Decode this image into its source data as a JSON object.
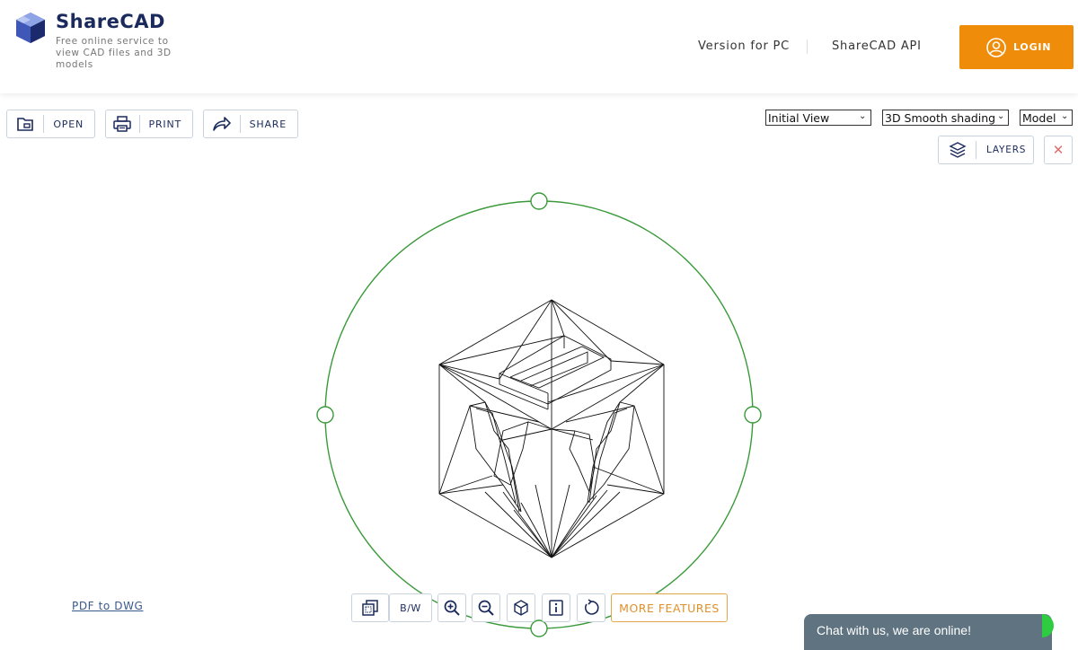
{
  "header": {
    "brand": "ShareCAD",
    "tagline": "Free online service to view CAD files and 3D models",
    "nav": [
      {
        "label": "Version for PC"
      },
      {
        "label": "ShareCAD API"
      }
    ],
    "login_label": "LOGIN",
    "login_color": "#ef8d0a"
  },
  "toolbar": {
    "open_label": "OPEN",
    "print_label": "PRINT",
    "share_label": "SHARE"
  },
  "view_controls": {
    "view_select": {
      "selected": "Initial View"
    },
    "shading_select": {
      "selected": "3D Smooth shading"
    },
    "space_select": {
      "selected": "Model"
    },
    "layers_label": "LAYERS",
    "close_symbol": "✕"
  },
  "footer": {
    "pdf_link": "PDF to DWG",
    "bw_label": "B/W",
    "more_label": "MORE FEATURES",
    "chat_text": "Chat with us, we are online!"
  },
  "icons": [
    "logo-cube-icon",
    "folder-icon",
    "printer-icon",
    "share-arrow-icon",
    "user-circle-icon",
    "layers-icon",
    "close-icon",
    "fit-extents-icon",
    "zoom-in-icon",
    "zoom-out-icon",
    "3d-cube-icon",
    "info-icon",
    "rotate-icon"
  ],
  "colors": {
    "orbit": "#3a9a3a",
    "accent": "#ef8d0a",
    "brand": "#1b2a5c"
  }
}
